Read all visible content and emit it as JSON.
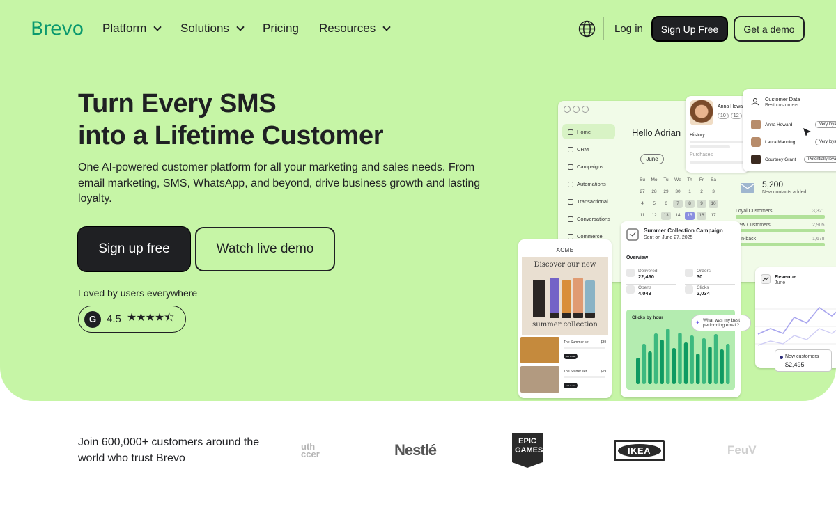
{
  "nav": {
    "logo": "Brevo",
    "items": [
      {
        "label": "Platform",
        "dropdown": true
      },
      {
        "label": "Solutions",
        "dropdown": true
      },
      {
        "label": "Pricing",
        "dropdown": false
      },
      {
        "label": "Resources",
        "dropdown": true
      }
    ],
    "login": "Log in",
    "signup": "Sign Up Free",
    "demo": "Get a demo"
  },
  "hero": {
    "title_line1": "Turn Every SMS",
    "title_line2": "into a Lifetime Customer",
    "subtitle": "One AI-powered customer platform for all your marketing and sales needs. From email marketing, SMS, WhatsApp, and beyond, drive business growth and lasting loyalty.",
    "cta_primary": "Sign up free",
    "cta_secondary": "Watch live demo",
    "loved": "Loved by users everywhere",
    "rating_badge": "G",
    "rating_value": "4.5",
    "rating_stars": "★★★★⯪"
  },
  "mockup": {
    "sidebar": [
      "Home",
      "CRM",
      "Campaigns",
      "Automations",
      "Transactional",
      "Conversations",
      "Commerce"
    ],
    "greeting": "Hello Adrian",
    "calendar_month": "June",
    "weekdays": [
      "Su",
      "Mo",
      "Tu",
      "We",
      "Th",
      "Fr",
      "Sa"
    ],
    "calendar_rows": [
      [
        "27",
        "28",
        "29",
        "30",
        "1",
        "2",
        "3"
      ],
      [
        "4",
        "5",
        "6",
        "7",
        "8",
        "9",
        "10"
      ],
      [
        "11",
        "12",
        "13",
        "14",
        "15",
        "16",
        "17"
      ]
    ],
    "profile": {
      "name": "Anna Howard",
      "chips": [
        "10",
        "12"
      ],
      "history": "History",
      "purchases": "Purchases"
    },
    "customer_data": {
      "title": "Customer Data",
      "subtitle": "Best customers",
      "rows": [
        {
          "name": "Anna Howard",
          "tag": "Very loyal"
        },
        {
          "name": "Laura Manning",
          "tag": "Very loyal"
        },
        {
          "name": "Courtney Grant",
          "tag": "Potentially loyal"
        }
      ]
    },
    "contacts": {
      "value": "5,200",
      "label": "New contacts added"
    },
    "loyalty": [
      {
        "label": "Loyal Customers",
        "value": "3,321"
      },
      {
        "label": "New Customers",
        "value": "2,905"
      },
      {
        "label": "Win-back",
        "value": "1,678"
      }
    ],
    "campaign": {
      "title": "Summer Collection Campaign",
      "date": "Sent on June 27, 2025",
      "overview": "Overview",
      "metrics": [
        {
          "label": "Delivered",
          "value": "22,490"
        },
        {
          "label": "Orders",
          "value": "30"
        },
        {
          "label": "Opens",
          "value": "4,043"
        },
        {
          "label": "Clicks",
          "value": "2,034"
        }
      ],
      "clicks_title": "Clicks by hour"
    },
    "bubble": "What was my best performing email?",
    "shop": {
      "brand": "ACME",
      "headline": "Discover our new",
      "footer": "summer collection",
      "items": [
        {
          "name": "The Summer set",
          "price": "$39"
        },
        {
          "name": "The Starter set",
          "price": "$29"
        }
      ],
      "button": "Add to cart"
    },
    "revenue": {
      "title": "Revenue",
      "month": "June",
      "new_customers_label": "New customers",
      "new_customers_value": "$2,495"
    }
  },
  "trust": {
    "text": "Join 600,000+ customers around the world who trust Brevo",
    "logos": [
      "uth ccer",
      "Nestlé",
      "EPIC GAMES",
      "IKEA",
      "FeuV"
    ]
  },
  "colors": {
    "hero_bg": "#c6f5a6",
    "brand_green": "#0b996e",
    "dark": "#1f2023",
    "chart_green": "#0f9a62"
  }
}
